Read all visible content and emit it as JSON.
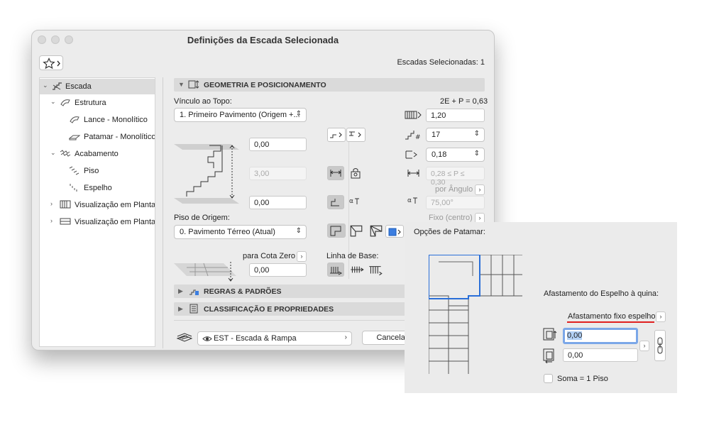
{
  "window": {
    "title": "Definições da Escada Selecionada"
  },
  "header": {
    "selected_count": "Escadas Selecionadas: 1"
  },
  "tree": {
    "items": [
      {
        "label": "Escada",
        "icon": "stair-icon"
      },
      {
        "label": "Estrutura",
        "icon": "structure-icon"
      },
      {
        "label": "Lance - Monolítico",
        "icon": "flight-icon"
      },
      {
        "label": "Patamar - Monolítico",
        "icon": "landing-icon"
      },
      {
        "label": "Acabamento",
        "icon": "finish-icon"
      },
      {
        "label": "Piso",
        "icon": "tread-icon"
      },
      {
        "label": "Espelho",
        "icon": "riser-icon"
      },
      {
        "label": "Visualização em Planta",
        "icon": "floorplan-icon"
      },
      {
        "label": "Visualização em Planta d",
        "icon": "floorplan-2-icon"
      }
    ]
  },
  "sections": {
    "geometry": "GEOMETRIA E POSICIONAMENTO",
    "rules": "REGRAS & PADRÕES",
    "classification": "CLASSIFICAÇÃO E PROPRIEDADES"
  },
  "geometry": {
    "top_link_label": "Vínculo ao Topo:",
    "formula": "2E + P = 0,63",
    "top_link_value": "1. Primeiro Pavimento (Origem +...",
    "top_offset": "0,00",
    "height": "3,00",
    "bottom_offset": "0,00",
    "home_story_label": "Piso de Origem:",
    "home_story_value": "0. Pavimento Térreo (Atual)",
    "to_zero_label": "para Cota Zero",
    "to_zero_value": "0,00",
    "width": "1,20",
    "riser_count": "17",
    "riser_height": "0,18",
    "tread_range": "0,28 ≤ P ≤ 0,30",
    "by_angle": "por Ângulo",
    "angle": "75,00°",
    "fixed_center": "Fixo (centro)",
    "baseline_label": "Linha de Base:"
  },
  "footer": {
    "layer": "EST - Escada & Rampa",
    "cancel": "Cancelar"
  },
  "landing": {
    "title": "Opções de Patamar:",
    "offset_label": "Afastamento do Espelho à quina:",
    "fixed_offset": "Afastamento fixo espelho",
    "value1": "0,00",
    "value2": "0,00",
    "sum_label": "Soma = 1 Piso"
  }
}
